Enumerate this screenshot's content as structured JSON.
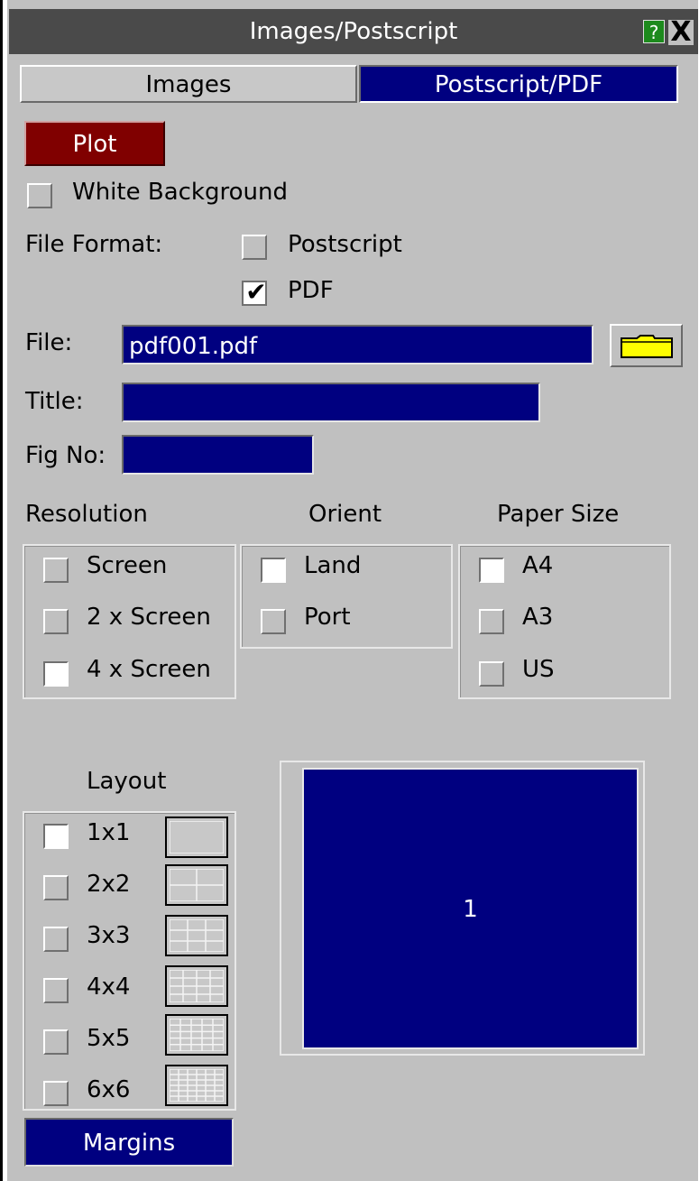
{
  "window": {
    "title": "Images/Postscript",
    "help_label": "?",
    "close_label": "X"
  },
  "tabs": [
    {
      "label": "Images",
      "active": false
    },
    {
      "label": "Postscript/PDF",
      "active": true
    }
  ],
  "plot_button": "Plot",
  "white_background": {
    "label": "White Background",
    "checked": false
  },
  "file_format": {
    "label": "File Format:",
    "options": [
      {
        "label": "Postscript",
        "checked": false
      },
      {
        "label": "PDF",
        "checked": true
      }
    ]
  },
  "file": {
    "label": "File:",
    "value": "pdf001.pdf"
  },
  "title_field": {
    "label": "Title:",
    "value": ""
  },
  "fig_no": {
    "label": "Fig No:",
    "value": ""
  },
  "resolution": {
    "label": "Resolution",
    "options": [
      {
        "label": "Screen",
        "selected": false
      },
      {
        "label": "2 x Screen",
        "selected": false
      },
      {
        "label": "4 x Screen",
        "selected": true
      }
    ]
  },
  "orient": {
    "label": "Orient",
    "options": [
      {
        "label": "Land",
        "selected": true
      },
      {
        "label": "Port",
        "selected": false
      }
    ]
  },
  "paper_size": {
    "label": "Paper Size",
    "options": [
      {
        "label": "A4",
        "selected": true
      },
      {
        "label": "A3",
        "selected": false
      },
      {
        "label": "US",
        "selected": false
      }
    ]
  },
  "layout": {
    "label": "Layout",
    "options": [
      {
        "label": "1x1",
        "selected": true
      },
      {
        "label": "2x2",
        "selected": false
      },
      {
        "label": "3x3",
        "selected": false
      },
      {
        "label": "4x4",
        "selected": false
      },
      {
        "label": "5x5",
        "selected": false
      },
      {
        "label": "6x6",
        "selected": false
      }
    ]
  },
  "preview": {
    "page_number": "1"
  },
  "margins_button": "Margins",
  "colors": {
    "field_bg": "#000080",
    "plot_button": "#800000",
    "panel": "#c0c0c0",
    "folder": "#ffff00"
  }
}
